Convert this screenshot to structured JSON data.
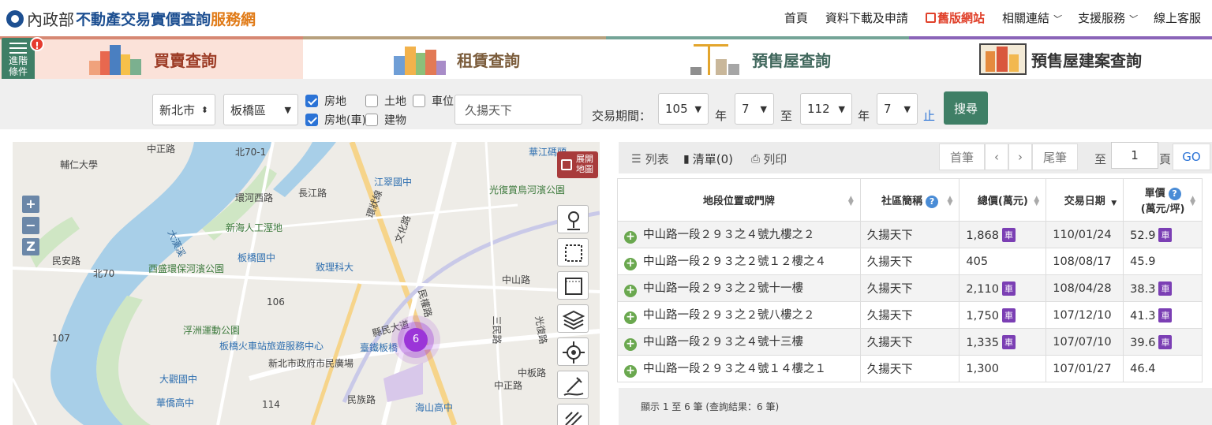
{
  "header": {
    "logo_ministry": "內政部",
    "logo_main": "不動產交易實價查詢",
    "logo_accent": "服務網",
    "nav": {
      "home": "首頁",
      "download": "資料下載及申請",
      "old_site": "舊版網站",
      "links": "相關連結",
      "support": "支援服務",
      "online": "線上客服"
    }
  },
  "advanced": {
    "label_line1": "進階",
    "label_line2": "條件",
    "badge": "!"
  },
  "tabs": {
    "buy": "買賣查詢",
    "rent": "租賃查詢",
    "presale": "預售屋查詢",
    "presale_case": "預售屋建案查詢"
  },
  "filters": {
    "city": "新北市",
    "district": "板橋區",
    "types": {
      "house": "房地",
      "land": "土地",
      "parking": "車位",
      "house_car": "房地(車)",
      "building": "建物"
    },
    "keyword": "久揚天下",
    "period_label": "交易期間：",
    "from_year": "105",
    "from_month": "7",
    "to_year": "112",
    "to_month": "7",
    "year_unit": "年",
    "to_label": "至",
    "stop_label": "止",
    "search": "搜尋"
  },
  "map": {
    "expand_line1": "展開",
    "expand_line2": "地圖",
    "cluster_count": "6",
    "zoom_in": "+",
    "zoom_out": "−",
    "zoom_z": "Z",
    "labels": {
      "l1": "輔仁大學",
      "l2": "中正路",
      "l3": "北70-1",
      "l4": "華江碼頭",
      "l5": "環河西路",
      "l6": "長江路",
      "l7": "江翠國中",
      "l8": "光復賞鳥河濱公園",
      "l9": "新海人工溼地",
      "l10": "板橋國中",
      "l11": "民安路",
      "l12": "西盛環保河濱公園",
      "l13": "致理科大",
      "l14": "北70",
      "l15": "106",
      "l16": "浮洲運動公園",
      "l17": "板橋火車站旅遊服務中心",
      "l18": "臺鐵板橋",
      "l19": "新北市政府市民廣場",
      "l20": "107",
      "l21": "大觀國中",
      "l22": "華僑高中",
      "l23": "114",
      "l24": "海山高中",
      "l25": "環狀線",
      "l26": "中山路",
      "l27": "民族路",
      "l28": "文化路",
      "l29": "三民路",
      "l30": "中正路",
      "l31": "民權路",
      "l32": "縣民大道",
      "l33": "大漢溪",
      "l34": "中板路",
      "l35": "光復路"
    }
  },
  "results": {
    "toolbar": {
      "list": "列表",
      "bookmark": "清單(0)",
      "print": "列印",
      "first": "首筆",
      "prev": "‹",
      "next": "›",
      "last": "尾筆",
      "to": "至",
      "page": "1",
      "page_unit": "頁",
      "go": "GO"
    },
    "columns": {
      "address": "地段位置或門牌",
      "community": "社區簡稱",
      "total": "總價(萬元)",
      "date": "交易日期",
      "unit_line1": "單價",
      "unit_line2": "(萬元/坪)"
    },
    "car_tag": "車",
    "rows": [
      {
        "address": "中山路一段２９３之４號九樓之２",
        "community": "久揚天下",
        "total": "1,868",
        "date": "110/01/24",
        "unit": "52.9"
      },
      {
        "address": "中山路一段２９３之２號１２樓之４",
        "community": "久揚天下",
        "total": "405",
        "date": "108/08/17",
        "unit": "45.9"
      },
      {
        "address": "中山路一段２９３之２號十一樓",
        "community": "久揚天下",
        "total": "2,110",
        "date": "108/04/28",
        "unit": "38.3"
      },
      {
        "address": "中山路一段２９３之２號八樓之２",
        "community": "久揚天下",
        "total": "1,750",
        "date": "107/12/10",
        "unit": "41.3"
      },
      {
        "address": "中山路一段２９３之４號十三樓",
        "community": "久揚天下",
        "total": "1,335",
        "date": "107/07/10",
        "unit": "39.6"
      },
      {
        "address": "中山路一段２９３之４號１４樓之１",
        "community": "久揚天下",
        "total": "1,300",
        "date": "107/01/27",
        "unit": "46.4"
      }
    ],
    "footer": "顯示 1 至 6 筆 (查詢結果：6 筆)"
  }
}
